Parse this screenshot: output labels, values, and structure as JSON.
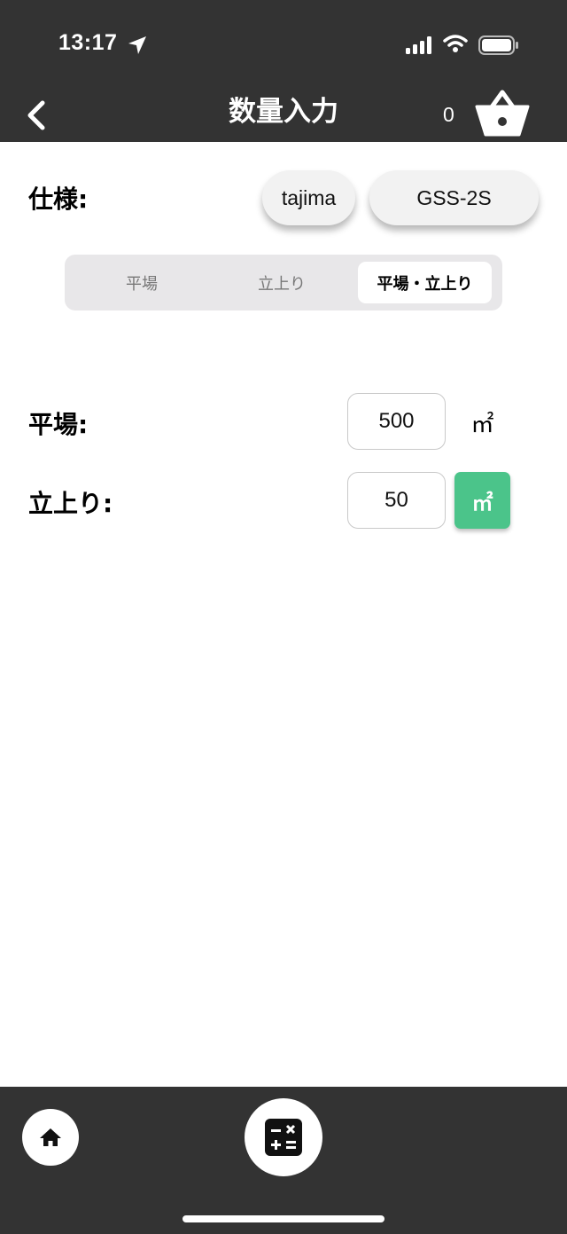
{
  "status_bar": {
    "time": "13:17"
  },
  "nav": {
    "title": "数量入力",
    "cart_count": "0"
  },
  "spec": {
    "label": "仕様:",
    "maker": "tajima",
    "product": "GSS-2S"
  },
  "segments": [
    {
      "label": "平場",
      "selected": false
    },
    {
      "label": "立上り",
      "selected": false
    },
    {
      "label": "平場・立上り",
      "selected": true
    }
  ],
  "rows": [
    {
      "label": "平場:",
      "value": "500",
      "unit": "㎡"
    },
    {
      "label": "立上り:",
      "value": "50",
      "unit": "㎡"
    }
  ],
  "colors": {
    "bar": "#333333",
    "accent": "#4bc48a"
  },
  "icons": [
    "location-arrow-icon",
    "signal-icon",
    "wifi-icon",
    "battery-icon",
    "back-chevron-icon",
    "basket-icon",
    "home-icon",
    "calculator-icon"
  ]
}
